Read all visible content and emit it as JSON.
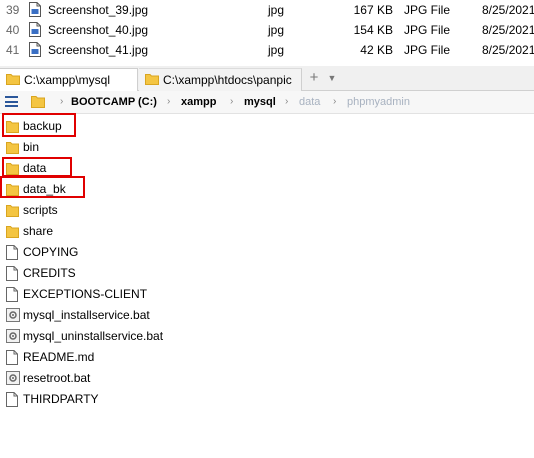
{
  "files": [
    {
      "num": "39",
      "name": "Screenshot_39.jpg",
      "ext": "jpg",
      "size": "167 KB",
      "type": "JPG File",
      "date": "8/25/2021"
    },
    {
      "num": "40",
      "name": "Screenshot_40.jpg",
      "ext": "jpg",
      "size": "154 KB",
      "type": "JPG File",
      "date": "8/25/2021"
    },
    {
      "num": "41",
      "name": "Screenshot_41.jpg",
      "ext": "jpg",
      "size": "42 KB",
      "type": "JPG File",
      "date": "8/25/2021"
    }
  ],
  "tabs": [
    {
      "label": "C:\\xampp\\mysql",
      "active": true
    },
    {
      "label": "C:\\xampp\\htdocs\\panpic",
      "active": false
    }
  ],
  "tab_add": "+",
  "tab_menu": "▼",
  "breadcrumb": {
    "sep": "›",
    "items": [
      {
        "label": "BOOTCAMP (C:)"
      },
      {
        "label": "xampp"
      },
      {
        "label": "mysql"
      },
      {
        "label": "data"
      },
      {
        "label": "phpmyadmin"
      }
    ]
  },
  "items": [
    {
      "label": "backup",
      "kind": "folder"
    },
    {
      "label": "bin",
      "kind": "folder"
    },
    {
      "label": "data",
      "kind": "folder"
    },
    {
      "label": "data_bk",
      "kind": "folder"
    },
    {
      "label": "scripts",
      "kind": "folder"
    },
    {
      "label": "share",
      "kind": "folder"
    },
    {
      "label": "COPYING",
      "kind": "file"
    },
    {
      "label": "CREDITS",
      "kind": "file"
    },
    {
      "label": "EXCEPTIONS-CLIENT",
      "kind": "file"
    },
    {
      "label": "mysql_installservice.bat",
      "kind": "bat"
    },
    {
      "label": "mysql_uninstallservice.bat",
      "kind": "bat"
    },
    {
      "label": "README.md",
      "kind": "file"
    },
    {
      "label": "resetroot.bat",
      "kind": "bat"
    },
    {
      "label": "THIRDPARTY",
      "kind": "file"
    }
  ],
  "colors": {
    "folder": "#f4c542",
    "highlight": "#e00000",
    "accent": "#2b579a"
  }
}
